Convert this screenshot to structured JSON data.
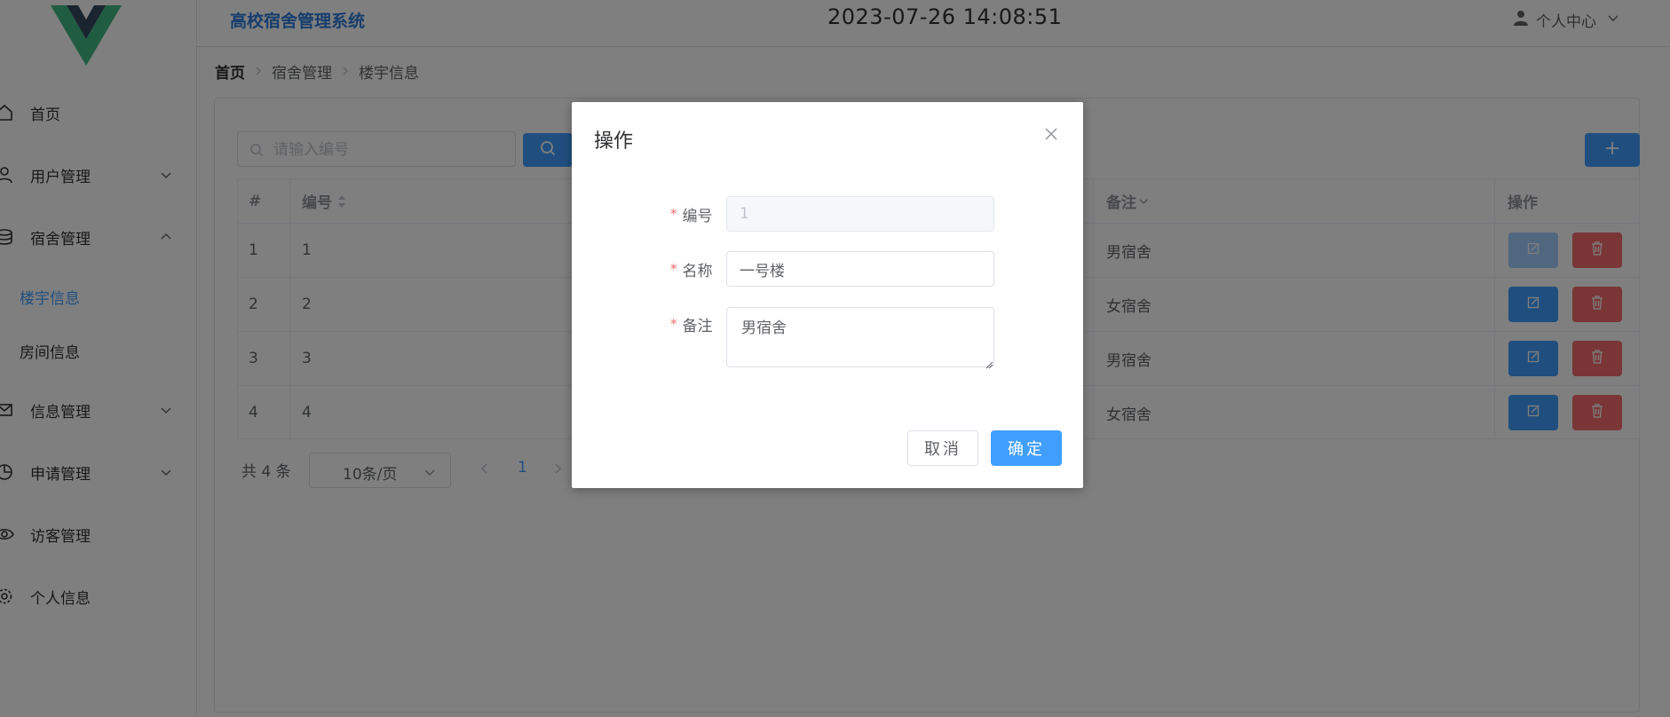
{
  "header": {
    "app_title": "高校宿舍管理系统",
    "datetime": "2023-07-26 14:08:51",
    "user_menu_label": "个人中心"
  },
  "sidebar": {
    "items": [
      {
        "label": "首页",
        "icon": "home-icon"
      },
      {
        "label": "用户管理",
        "icon": "user-icon",
        "expanded": false
      },
      {
        "label": "宿舍管理",
        "icon": "database-icon",
        "expanded": true,
        "children": [
          {
            "label": "楼宇信息",
            "active": true
          },
          {
            "label": "房间信息",
            "active": false
          }
        ]
      },
      {
        "label": "信息管理",
        "icon": "message-icon",
        "expanded": false
      },
      {
        "label": "申请管理",
        "icon": "pie-chart-icon",
        "expanded": false
      },
      {
        "label": "访客管理",
        "icon": "eye-icon"
      },
      {
        "label": "个人信息",
        "icon": "setting-icon"
      }
    ]
  },
  "breadcrumb": [
    "首页",
    "宿舍管理",
    "楼宇信息"
  ],
  "search": {
    "placeholder": "请输入编号",
    "value": ""
  },
  "table": {
    "columns": [
      "#",
      "编号",
      "备注",
      "操作"
    ],
    "rows": [
      {
        "index": "1",
        "code": "1",
        "remark": "男宿舍"
      },
      {
        "index": "2",
        "code": "2",
        "remark": "女宿舍"
      },
      {
        "index": "3",
        "code": "3",
        "remark": "男宿舍"
      },
      {
        "index": "4",
        "code": "4",
        "remark": "女宿舍"
      }
    ]
  },
  "pagination": {
    "total_text": "共 4 条",
    "page_size_label": "10条/页",
    "current_page": "1"
  },
  "dialog": {
    "title": "操作",
    "fields": [
      {
        "label": "编号",
        "value": "1",
        "disabled": true
      },
      {
        "label": "名称",
        "value": "一号楼",
        "disabled": false
      },
      {
        "label": "备注",
        "value": "男宿舍",
        "disabled": false
      }
    ],
    "cancel_label": "取消",
    "confirm_label": "确定"
  },
  "colors": {
    "primary": "#409eff",
    "danger": "#f56c6c",
    "title": "#2d7bd8",
    "overlay": "rgba(0,0,0,0.5)"
  }
}
